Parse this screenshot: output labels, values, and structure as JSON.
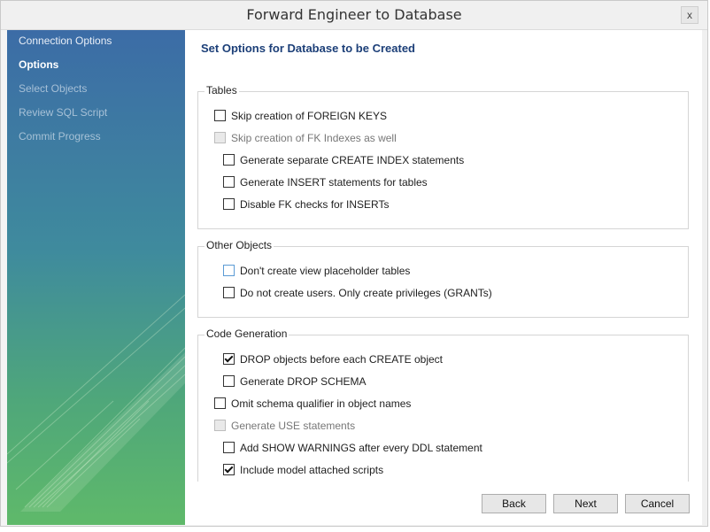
{
  "window": {
    "title": "Forward Engineer to Database",
    "close_label": "x"
  },
  "sidebar": {
    "items": [
      {
        "label": "Connection Options"
      },
      {
        "label": "Options"
      },
      {
        "label": "Select Objects"
      },
      {
        "label": "Review SQL Script"
      },
      {
        "label": "Commit Progress"
      }
    ],
    "active_index": 1
  },
  "content": {
    "heading": "Set Options for Database to be Created",
    "groups": [
      {
        "title": "Tables",
        "options": [
          {
            "label": "Skip creation of FOREIGN KEYS",
            "checked": false,
            "disabled": false
          },
          {
            "label": "Skip creation of FK Indexes as well",
            "checked": false,
            "disabled": true
          },
          {
            "label": "Generate separate CREATE INDEX statements",
            "checked": false,
            "disabled": false
          },
          {
            "label": "Generate INSERT statements for tables",
            "checked": false,
            "disabled": false
          },
          {
            "label": "Disable FK checks for INSERTs",
            "checked": false,
            "disabled": false
          }
        ]
      },
      {
        "title": "Other Objects",
        "options": [
          {
            "label": "Don't create view placeholder tables",
            "checked": false,
            "disabled": false
          },
          {
            "label": "Do not create users. Only create privileges (GRANTs)",
            "checked": false,
            "disabled": false
          }
        ]
      },
      {
        "title": "Code Generation",
        "options": [
          {
            "label": "DROP objects before each CREATE object",
            "checked": true,
            "disabled": false
          },
          {
            "label": "Generate DROP SCHEMA",
            "checked": false,
            "disabled": false
          },
          {
            "label": "Omit schema qualifier in object names",
            "checked": false,
            "disabled": false
          },
          {
            "label": "Generate USE statements",
            "checked": false,
            "disabled": true
          },
          {
            "label": "Add SHOW WARNINGS after every DDL statement",
            "checked": false,
            "disabled": false
          },
          {
            "label": "Include model attached scripts",
            "checked": true,
            "disabled": false
          }
        ]
      }
    ]
  },
  "buttons": {
    "back": "Back",
    "next": "Next",
    "cancel": "Cancel"
  }
}
